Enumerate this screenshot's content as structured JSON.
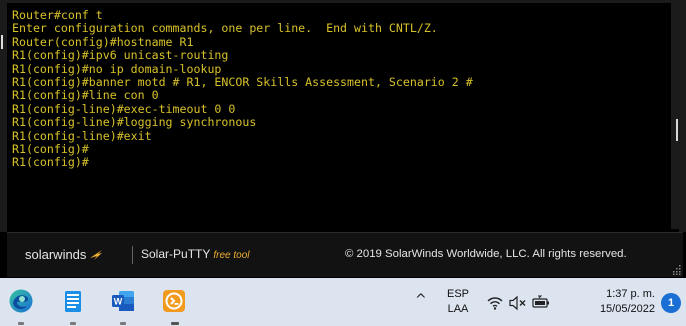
{
  "terminal": {
    "lines": [
      "Router#conf t",
      "Enter configuration commands, one per line.  End with CNTL/Z.",
      "Router(config)#hostname R1",
      "R1(config)#ipv6 unicast-routing",
      "R1(config)#no ip domain-lookup",
      "R1(config)#banner motd # R1, ENCOR Skills Assessment, Scenario 2 #",
      "R1(config)#line con 0",
      "R1(config-line)#exec-timeout 0 0",
      "R1(config-line)#logging synchronous",
      "R1(config-line)#exit",
      "R1(config)#",
      "R1(config)#"
    ],
    "text_color": "#d8c22a",
    "background": "#000000"
  },
  "footer": {
    "brand": "solarwinds",
    "product": "Solar-PuTTY",
    "free_tag": "free tool",
    "copyright": "© 2019 SolarWinds Worldwide, LLC. All rights reserved.",
    "accent": "#f0b030"
  },
  "taskbar": {
    "apps": [
      {
        "name": "edge-icon"
      },
      {
        "name": "notepad-icon"
      },
      {
        "name": "word-icon"
      },
      {
        "name": "solar-putty-icon"
      }
    ],
    "language_line1": "ESP",
    "language_line2": "LAA",
    "time": "1:37 p. m.",
    "date": "15/05/2022",
    "notification_count": "1"
  }
}
